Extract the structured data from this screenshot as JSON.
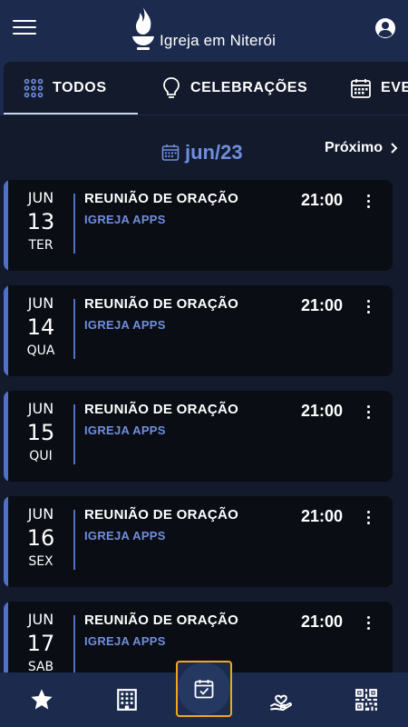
{
  "header": {
    "title": "Igreja em Niterói"
  },
  "tabs": [
    {
      "label": "TODOS",
      "icon": "grid-dots-icon",
      "active": true
    },
    {
      "label": "CELEBRAÇÕES",
      "icon": "lightbulb-icon",
      "active": false
    },
    {
      "label": "EVE",
      "icon": "calendar-icon",
      "active": false
    }
  ],
  "month_nav": {
    "current": "jun/23",
    "next_label": "Próximo"
  },
  "events": [
    {
      "month": "JUN",
      "day": "13",
      "weekday": "TER",
      "title": "REUNIÃO DE ORAÇÃO",
      "org": "IGREJA APPS",
      "time": "21:00"
    },
    {
      "month": "JUN",
      "day": "14",
      "weekday": "QUA",
      "title": "REUNIÃO DE ORAÇÃO",
      "org": "IGREJA APPS",
      "time": "21:00"
    },
    {
      "month": "JUN",
      "day": "15",
      "weekday": "QUI",
      "title": "REUNIÃO DE ORAÇÃO",
      "org": "IGREJA APPS",
      "time": "21:00"
    },
    {
      "month": "JUN",
      "day": "16",
      "weekday": "SEX",
      "title": "REUNIÃO DE ORAÇÃO",
      "org": "IGREJA APPS",
      "time": "21:00"
    },
    {
      "month": "JUN",
      "day": "17",
      "weekday": "SAB",
      "title": "REUNIÃO DE ORAÇÃO",
      "org": "IGREJA APPS",
      "time": "21:00"
    }
  ],
  "bottom_nav": [
    {
      "icon": "star-icon"
    },
    {
      "icon": "building-icon"
    },
    {
      "icon": "calendar-check-icon",
      "active": true
    },
    {
      "icon": "heart-hand-icon"
    },
    {
      "icon": "qr-code-icon"
    }
  ],
  "colors": {
    "header_bg": "#1b2a4d",
    "page_bg": "#121a2b",
    "card_bg": "#0a0d14",
    "accent": "#5170c9",
    "accent_text": "#6f8ee0",
    "active_highlight": "#f3a81c"
  }
}
